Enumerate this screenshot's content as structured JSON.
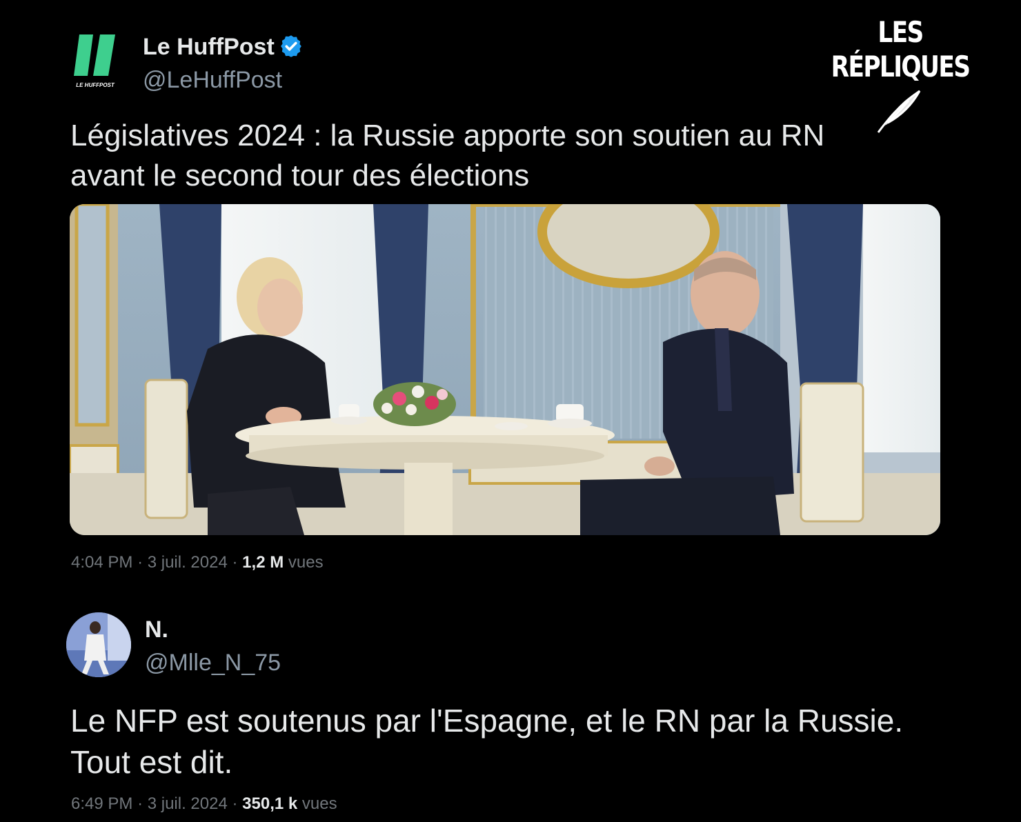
{
  "watermark": {
    "text": "LES RÉPLIQUES",
    "icon": "quill-icon"
  },
  "tweet1": {
    "logo_text": "LE HUFFPOST",
    "logo_color": "#3ecf8e",
    "author_name": "Le HuffPost",
    "handle": "@LeHuffPost",
    "verified_color": "#1d9bf0",
    "text_line1": "Législatives 2024 : la Russie apporte son soutien au RN",
    "text_line2": "avant le second tour des élections",
    "time": "4:04 PM",
    "date": "3 juil. 2024",
    "views_count": "1,2 M",
    "views_label": "vues",
    "sep": "·"
  },
  "tweet2": {
    "author_name": "N.",
    "handle": "@Mlle_N_75",
    "text_line1": "Le NFP est soutenus par l'Espagne, et le RN par la Russie.",
    "text_line2": "Tout est dit.",
    "time": "6:49 PM",
    "date": "3 juil. 2024",
    "views_count": "350,1 k",
    "views_label": "vues",
    "sep": "·"
  }
}
